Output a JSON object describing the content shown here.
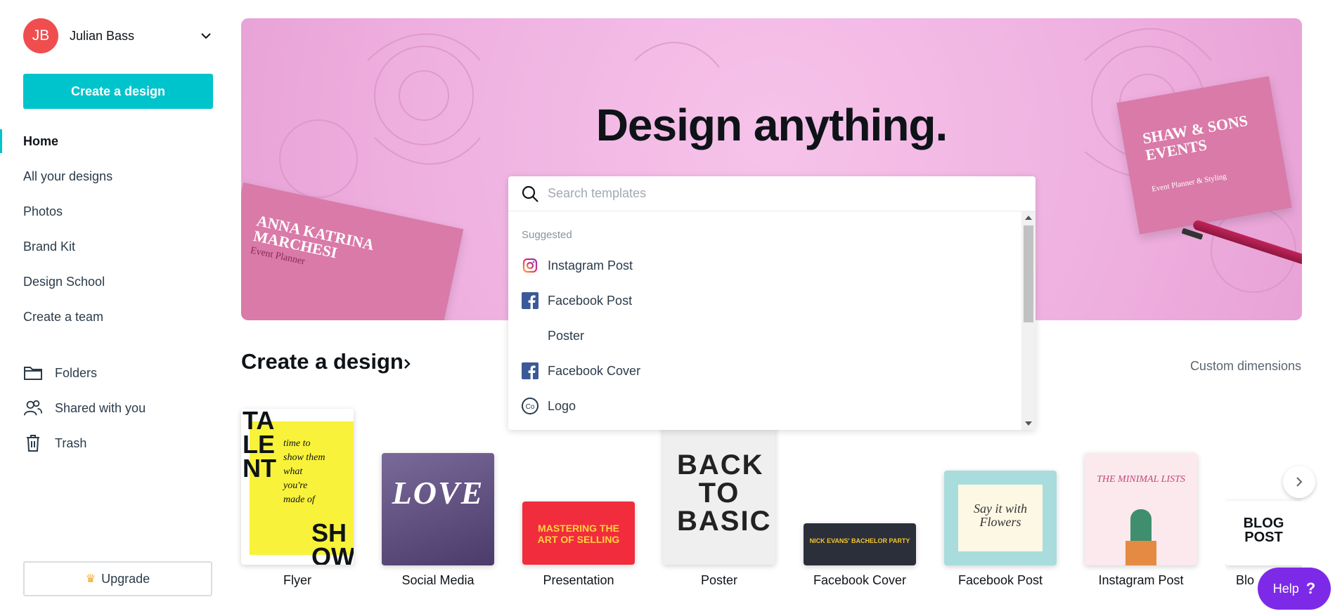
{
  "user": {
    "initials": "JB",
    "name": "Julian Bass"
  },
  "sidebar": {
    "create_label": "Create a design",
    "nav": [
      "Home",
      "All your designs",
      "Photos",
      "Brand Kit",
      "Design School",
      "Create a team"
    ],
    "nav2": [
      "Folders",
      "Shared with you",
      "Trash"
    ],
    "upgrade_label": "Upgrade"
  },
  "hero": {
    "title": "Design anything.",
    "card_left_name": "ANNA KATRINA MARCHESI",
    "card_left_role": "Event Planner",
    "card_right_name": "SHAW & SONS EVENTS",
    "card_right_role": "Event Planner & Styling"
  },
  "search": {
    "placeholder": "Search templates",
    "suggested_label": "Suggested",
    "suggestions": [
      "Instagram Post",
      "Facebook Post",
      "Poster",
      "Facebook Cover",
      "Logo"
    ]
  },
  "section": {
    "title": "Create a design",
    "custom_label": "Custom dimensions"
  },
  "tiles": [
    {
      "label": "Flyer",
      "art": "TA LE NT",
      "art2": "SH OW"
    },
    {
      "label": "Social Media",
      "art": "LOVE"
    },
    {
      "label": "Presentation",
      "art": "MASTERING THE ART OF SELLING"
    },
    {
      "label": "Poster",
      "art": "BACK TO BASIC"
    },
    {
      "label": "Facebook Cover",
      "art": "NICK EVANS' BACHELOR PARTY"
    },
    {
      "label": "Facebook Post",
      "art": "Say it with Flowers"
    },
    {
      "label": "Instagram Post",
      "art": "THE MINIMAL LISTS"
    },
    {
      "label": "Blo",
      "art": "BLOG POST"
    }
  ],
  "help": {
    "label": "Help",
    "mark": "?"
  },
  "colors": {
    "accent": "#00c4cc",
    "avatar": "#f04e4e",
    "help": "#7d2ae8",
    "hero": "#f2b8e4"
  }
}
